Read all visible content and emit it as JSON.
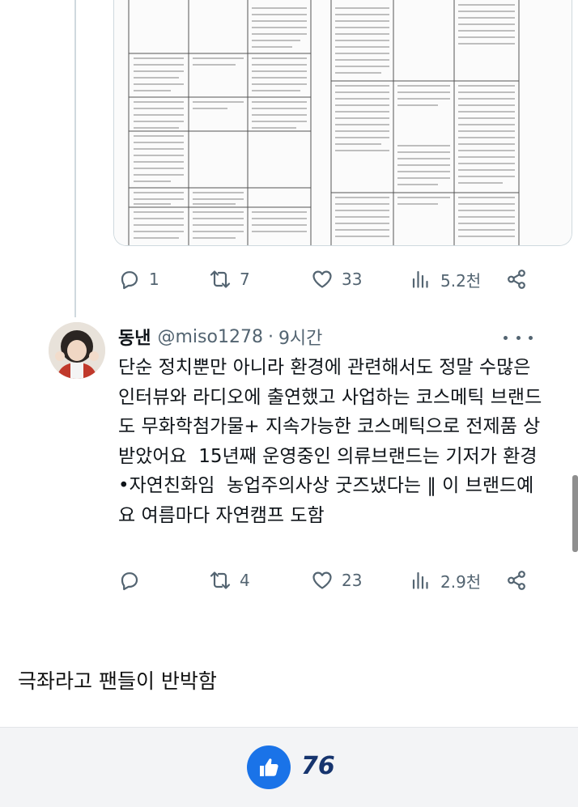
{
  "quoted_tweet": {
    "stats": {
      "replies": "1",
      "retweets": "7",
      "likes": "33",
      "views": "5.2천"
    }
  },
  "reply_tweet": {
    "display_name": "동낸",
    "handle": "@miso1278",
    "separator": "·",
    "time": "9시간",
    "text": "단순 정치뿐만 아니라 환경에 관련해서도 정말 수많은 인터뷰와 라디오에 출연했고 사업하는 코스메틱 브랜드도 무화학첨가물+ 지속가능한 코스메틱으로 전제품 상받았어요  15년째 운영중인 의류브랜드는 기저가 환경•자연친화임  농업주의사상 굿즈냈다는 ‖ 이 브랜드예요 여름마다 자연캠프 도함",
    "stats": {
      "replies": "",
      "retweets": "4",
      "likes": "23",
      "views": "2.9천"
    }
  },
  "caption": "극좌라고 팬들이 반박함",
  "post_like": {
    "count": "76"
  },
  "icons": {
    "reply": "reply-icon",
    "retweet": "retweet-icon",
    "like": "heart-icon",
    "views": "views-icon",
    "share": "share-icon",
    "more": "more-icon",
    "thumbs_up": "thumbs-up-icon"
  },
  "colors": {
    "icon_gray": "#536471",
    "text": "#0f1419",
    "like_button": "#1a73e8",
    "like_count": "#16346e",
    "footer_bg": "#f3f4f6"
  }
}
